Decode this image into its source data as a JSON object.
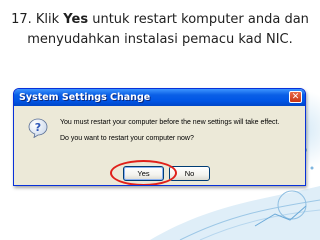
{
  "slide": {
    "title_prefix": "17. Klik ",
    "title_bold": "Yes",
    "title_suffix": " untuk restart komputer anda dan menyudahkan instalasi pemacu kad NIC."
  },
  "dialog": {
    "title": "System Settings Change",
    "close_symbol": "✕",
    "icon": "question-icon",
    "message_line_1": "You must restart your computer before the new settings will take effect.",
    "message_line_2": "Do you want to restart your computer now?",
    "yes_label": "Yes",
    "no_label": "No"
  },
  "colors": {
    "titlebar": "#0055e5",
    "dialog_bg": "#ece9d8",
    "highlight": "#e0201a"
  }
}
